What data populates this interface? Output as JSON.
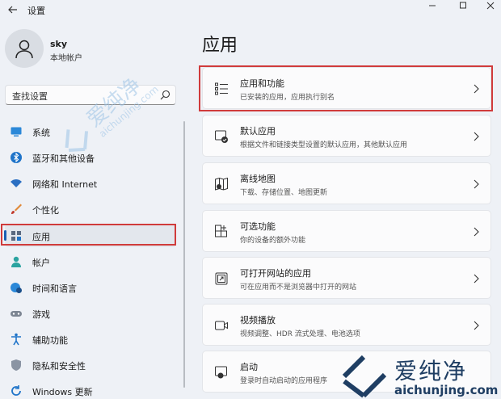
{
  "window": {
    "title": "设置"
  },
  "user": {
    "name": "sky",
    "account_type": "本地帐户"
  },
  "search": {
    "placeholder": "查找设置"
  },
  "sidebar": {
    "items": [
      {
        "label": "系统",
        "icon": "monitor-icon"
      },
      {
        "label": "蓝牙和其他设备",
        "icon": "bluetooth-icon"
      },
      {
        "label": "网络和 Internet",
        "icon": "wifi-icon"
      },
      {
        "label": "个性化",
        "icon": "brush-icon"
      },
      {
        "label": "应用",
        "icon": "apps-icon",
        "selected": true
      },
      {
        "label": "帐户",
        "icon": "person-icon"
      },
      {
        "label": "时间和语言",
        "icon": "globe-clock-icon"
      },
      {
        "label": "游戏",
        "icon": "gamepad-icon"
      },
      {
        "label": "辅助功能",
        "icon": "accessibility-icon"
      },
      {
        "label": "隐私和安全性",
        "icon": "shield-icon"
      },
      {
        "label": "Windows 更新",
        "icon": "update-icon"
      }
    ]
  },
  "main": {
    "title": "应用",
    "cards": [
      {
        "title": "应用和功能",
        "subtitle": "已安装的应用，应用执行别名",
        "icon": "apps-list-icon"
      },
      {
        "title": "默认应用",
        "subtitle": "根据文件和链接类型设置的默认应用，其他默认应用",
        "icon": "default-apps-icon"
      },
      {
        "title": "离线地图",
        "subtitle": "下载、存储位置、地图更新",
        "icon": "offline-map-icon"
      },
      {
        "title": "可选功能",
        "subtitle": "你的设备的额外功能",
        "icon": "optional-features-icon"
      },
      {
        "title": "可打开网站的应用",
        "subtitle": "可在应用而不是浏览器中打开的网站",
        "icon": "open-website-icon"
      },
      {
        "title": "视频播放",
        "subtitle": "视频调整、HDR 流式处理、电池选项",
        "icon": "video-icon"
      },
      {
        "title": "启动",
        "subtitle": "登录时自动启动的应用程序",
        "icon": "startup-icon"
      }
    ]
  },
  "watermark": {
    "cn": "爱纯净",
    "en": "aichunjing.com"
  },
  "colors": {
    "accent": "#1a5fb4",
    "highlight": "#d03b3b",
    "background": "#eef1f6",
    "card": "#fbfbfc"
  }
}
